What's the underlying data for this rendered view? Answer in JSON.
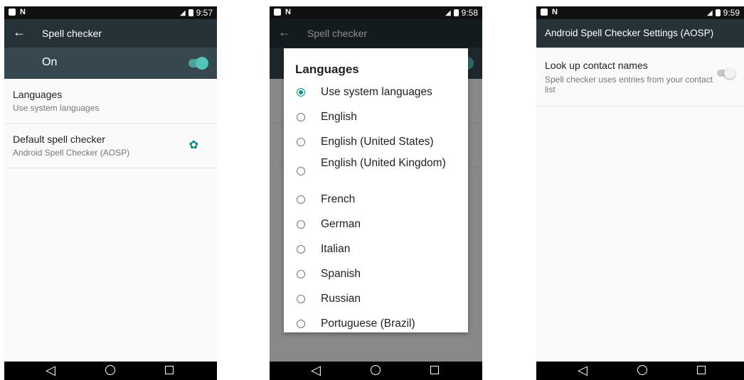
{
  "screen1": {
    "status": {
      "time": "9:57"
    },
    "title": "Spell checker",
    "switch_label": "On",
    "items": [
      {
        "title": "Languages",
        "subtitle": "Use system languages"
      },
      {
        "title": "Default spell checker",
        "subtitle": "Android Spell Checker (AOSP)"
      }
    ]
  },
  "screen2": {
    "status": {
      "time": "9:58"
    },
    "title": "Spell checker",
    "dialog": {
      "title": "Languages",
      "selected_index": 0,
      "options": [
        "Use system languages",
        "English",
        "English (United States)",
        "English (United Kingdom)",
        "French",
        "German",
        "Italian",
        "Spanish",
        "Russian",
        "Portuguese (Brazil)"
      ]
    }
  },
  "screen3": {
    "status": {
      "time": "9:59"
    },
    "title": "Android Spell Checker Settings (AOSP)",
    "item": {
      "title": "Look up contact names",
      "subtitle": "Spell checker uses entries from your contact list"
    }
  },
  "colors": {
    "accent": "#009688",
    "toolbar": "#263238",
    "switchbar": "#37474f"
  }
}
